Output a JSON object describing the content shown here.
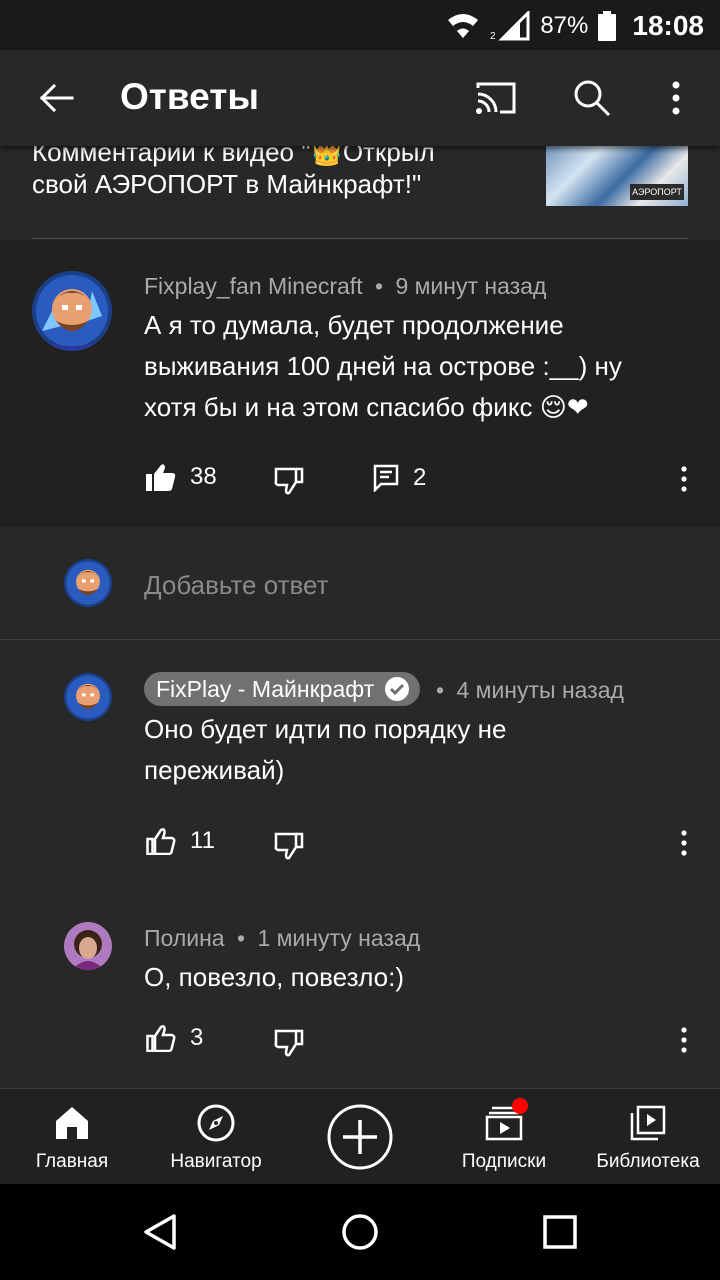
{
  "status_bar": {
    "battery_percent": "87%",
    "time": "18:08",
    "icons": [
      "wifi-icon",
      "signal-icon",
      "battery-icon"
    ]
  },
  "app_bar": {
    "title": "Ответы",
    "icons": [
      "back-arrow-icon",
      "cast-icon",
      "search-icon",
      "more-vertical-icon"
    ]
  },
  "video": {
    "line1": "Комментарии к видео \"👑Открыл",
    "line2": "свой АЭРОПОРТ в Майнкрафт!\"",
    "thumb_label": "АЭРОПОРТ"
  },
  "main_comment": {
    "author": "Fixplay_fan Minecraft",
    "time": "9 минут назад",
    "text_lines": [
      "А я то думала, будет продолжение",
      "выживания 100 дней на острове :__) ну",
      "хотя бы и на этом спасибо фикс 😌❤"
    ],
    "likes": "38",
    "replies": "2"
  },
  "add_reply": {
    "placeholder": "Добавьте ответ"
  },
  "replies": [
    {
      "author": "FixPlay - Майнкрафт",
      "verified": true,
      "time": "4 минуты назад",
      "text_lines": [
        "Оно будет идти по порядку не",
        "переживай)"
      ],
      "likes": "11"
    },
    {
      "author": "Полина",
      "time": "1 минуту назад",
      "text_lines": [
        "О, повезло, повезло:)"
      ],
      "likes": "3"
    }
  ],
  "separator": "•",
  "bottom_nav": [
    {
      "label": "Главная",
      "icon": "home-icon"
    },
    {
      "label": "Навигатор",
      "icon": "compass-icon"
    },
    {
      "label": "",
      "icon": "create-plus-icon"
    },
    {
      "label": "Подписки",
      "icon": "subscriptions-icon"
    },
    {
      "label": "Библиотека",
      "icon": "library-icon"
    }
  ],
  "colors": {
    "background": "#282828",
    "comment_bg": "#212121",
    "meta_text": "#aaaaaa",
    "notification_dot": "#ff0000"
  }
}
